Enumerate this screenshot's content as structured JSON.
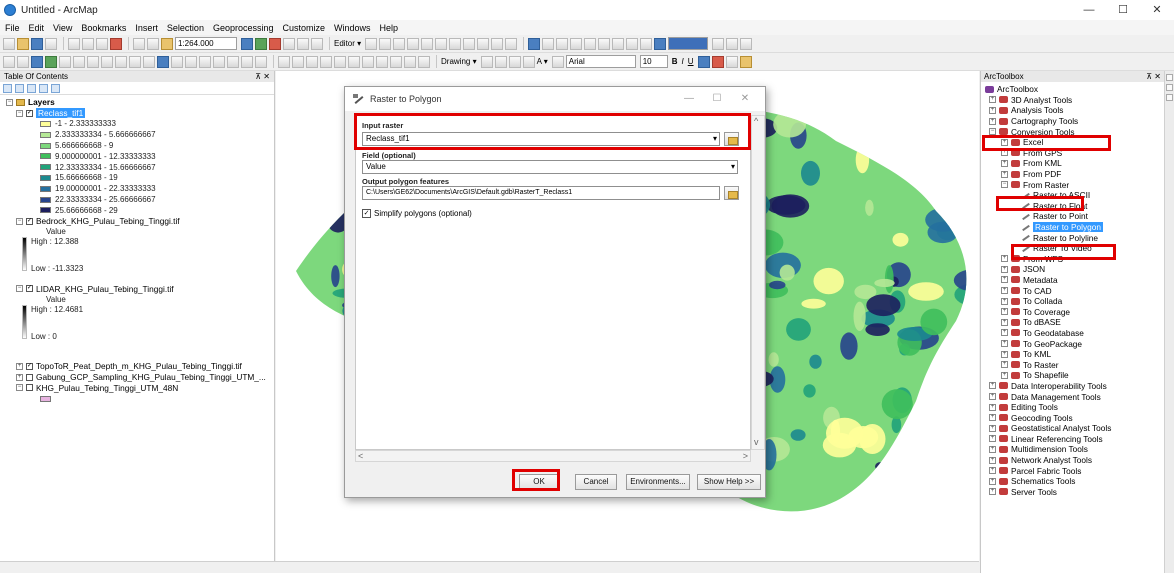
{
  "window": {
    "title": "Untitled - ArcMap",
    "min": "—",
    "max": "☐",
    "close": "✕"
  },
  "menu": [
    "File",
    "Edit",
    "View",
    "Bookmarks",
    "Insert",
    "Selection",
    "Geoprocessing",
    "Customize",
    "Windows",
    "Help"
  ],
  "toolbar": {
    "scale": "1:264.000",
    "editor": "Editor ▾",
    "drawing": "Drawing ▾",
    "font": "Arial",
    "font_size": "10",
    "bold": "B",
    "italic": "I",
    "underline": "U"
  },
  "toc": {
    "title": "Table Of Contents",
    "pin": "⊼ ✕",
    "layers_label": "Layers",
    "reclass_name": "Reclass_tif1",
    "reclass_classes": [
      {
        "label": "-1 - 2.333333333",
        "color": "#ffff99"
      },
      {
        "label": "2.333333334 - 5.666666667",
        "color": "#b5e896"
      },
      {
        "label": "5.666666668 - 9",
        "color": "#7dd87d"
      },
      {
        "label": "9.000000001 - 12.33333333",
        "color": "#3fbf5c"
      },
      {
        "label": "12.33333334 - 15.66666667",
        "color": "#21a37a"
      },
      {
        "label": "15.66666668 - 19",
        "color": "#1c8a8f"
      },
      {
        "label": "19.00000001 - 22.33333333",
        "color": "#25709f"
      },
      {
        "label": "22.33333334 - 25.66666667",
        "color": "#27448c"
      },
      {
        "label": "25.66666668 - 29",
        "color": "#1d1f5e"
      }
    ],
    "bedrock": {
      "name": "Bedrock_KHG_Pulau_Tebing_Tinggi.tif",
      "value": "Value",
      "high": "High : 12.388",
      "low": "Low : -11.3323"
    },
    "lidar": {
      "name": "LIDAR_KHG_Pulau_Tebing_Tinggi.tif",
      "value": "Value",
      "high": "High : 12.4681",
      "low": "Low : 0"
    },
    "topo": "TopoToR_Peat_Depth_m_KHG_Pulau_Tebing_Tinggi.tif",
    "gabung": "Gabung_GCP_Sampling_KHG_Pulau_Tebing_Tinggi_UTM_...",
    "khg": "KHG_Pulau_Tebing_Tinggi_UTM_48N",
    "khg_color": "#e7b3e0"
  },
  "dialog": {
    "title": "Raster to Polygon",
    "input_label": "Input raster",
    "input_value": "Reclass_tif1",
    "field_label": "Field (optional)",
    "field_value": "Value",
    "output_label": "Output polygon features",
    "output_value": "C:\\Users\\GE62\\Documents\\ArcGIS\\Default.gdb\\RasterT_Reclass1",
    "simplify_label": "Simplify polygons (optional)",
    "simplify_checked": "✓",
    "ok": "OK",
    "cancel": "Cancel",
    "environments": "Environments...",
    "help": "Show Help >>"
  },
  "arctoolbox": {
    "title": "ArcToolbox",
    "pin": "⊼ ✕",
    "root": "ArcToolbox",
    "top_items": [
      "3D Analyst Tools",
      "Analysis Tools",
      "Cartography Tools"
    ],
    "conversion": "Conversion Tools",
    "conversion_children_before": [
      "Excel",
      "From GPS",
      "From KML",
      "From PDF"
    ],
    "from_raster": "From Raster",
    "raster_tools": [
      "Raster to ASCII",
      "Raster to Float",
      "Raster to Point",
      "Raster to Polygon",
      "Raster to Polyline",
      "Raster To Video"
    ],
    "conversion_children_after": [
      "From WFS",
      "JSON",
      "Metadata",
      "To CAD",
      "To Collada",
      "To Coverage",
      "To dBASE",
      "To Geodatabase",
      "To GeoPackage",
      "To KML",
      "To Raster",
      "To Shapefile"
    ],
    "bottom_items": [
      "Data Interoperability Tools",
      "Data Management Tools",
      "Editing Tools",
      "Geocoding Tools",
      "Geostatistical Analyst Tools",
      "Linear Referencing Tools",
      "Multidimension Tools",
      "Network Analyst Tools",
      "Parcel Fabric Tools",
      "Schematics Tools",
      "Server Tools"
    ]
  },
  "colors": {
    "highlight_red": "#e00000",
    "selection_blue": "#3399ff"
  }
}
